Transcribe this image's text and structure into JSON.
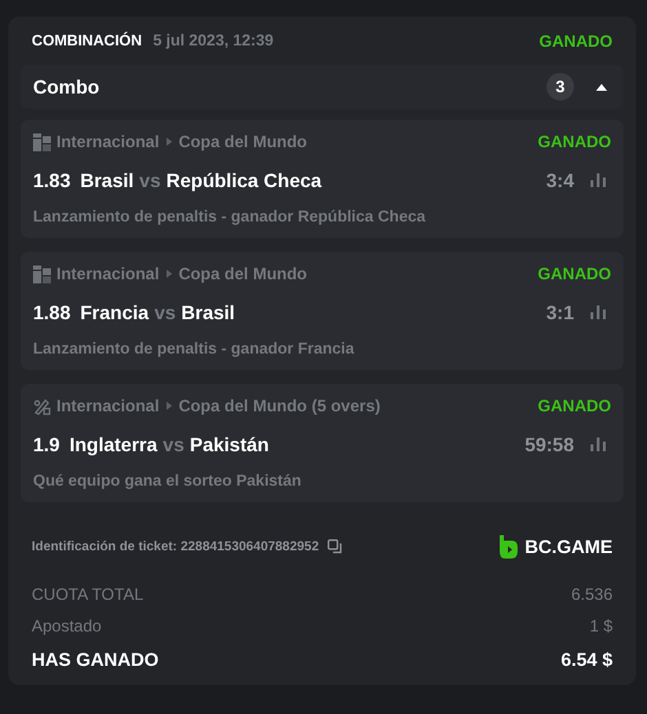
{
  "header": {
    "title": "COMBINACIÓN",
    "date": "5 jul 2023, 12:39",
    "status": "GANADO"
  },
  "combo": {
    "label": "Combo",
    "count": "3",
    "expanded": true
  },
  "legs": [
    {
      "kind": "football",
      "league": "Internacional",
      "tournament": "Copa del Mundo",
      "status": "GANADO",
      "odds": "1.83",
      "home": "Brasil",
      "vs": "vs",
      "away": "República Checa",
      "score": "3:4",
      "market": "Lanzamiento de penaltis - ganador República Checa"
    },
    {
      "kind": "football",
      "league": "Internacional",
      "tournament": "Copa del Mundo",
      "status": "GANADO",
      "odds": "1.88",
      "home": "Francia",
      "vs": "vs",
      "away": "Brasil",
      "score": "3:1",
      "market": "Lanzamiento de penaltis - ganador Francia"
    },
    {
      "kind": "cricket",
      "league": "Internacional",
      "tournament": "Copa del Mundo (5 overs)",
      "status": "GANADO",
      "odds": "1.9",
      "home": "Inglaterra",
      "vs": "vs",
      "away": "Pakistán",
      "score": "59:58",
      "market": "Qué equipo gana el sorteo Pakistán"
    }
  ],
  "ticket": {
    "label": "Identificación de ticket: 2288415306407882952",
    "brand": "BC.GAME"
  },
  "summary": [
    {
      "label": "CUOTA TOTAL",
      "value": "6.536",
      "kind": "plain"
    },
    {
      "label": "Apostado",
      "value": "1 $",
      "kind": "plain"
    },
    {
      "label": "HAS GANADO",
      "value": "6.54 $",
      "kind": "total"
    }
  ]
}
